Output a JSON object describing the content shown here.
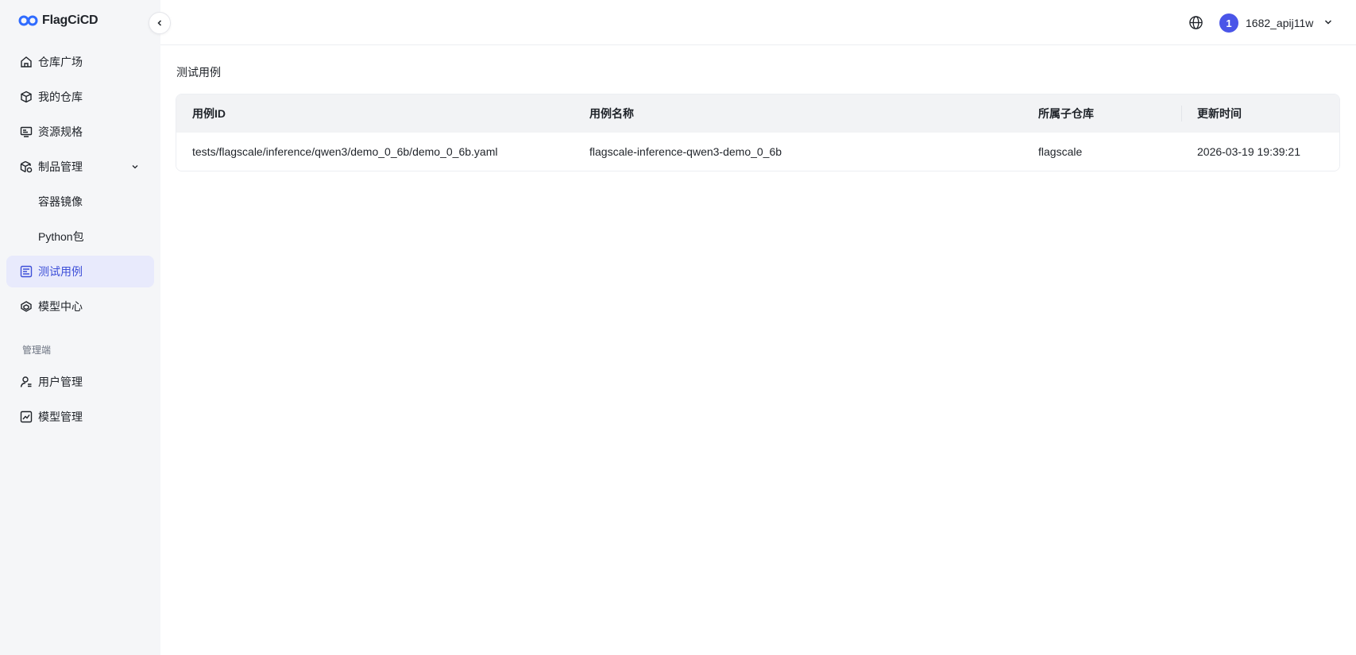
{
  "app": {
    "logo_text": "FlagCiCD"
  },
  "sidebar": {
    "items": [
      {
        "label": "仓库广场",
        "icon": "home-icon"
      },
      {
        "label": "我的仓库",
        "icon": "cube-icon"
      },
      {
        "label": "资源规格",
        "icon": "monitor-icon"
      },
      {
        "label": "制品管理",
        "icon": "package-icon",
        "expanded": true
      },
      {
        "label": "容器镜像"
      },
      {
        "label": "Python包"
      },
      {
        "label": "测试用例",
        "icon": "testcase-icon",
        "active": true
      },
      {
        "label": "模型中心",
        "icon": "model-icon"
      }
    ],
    "admin_section_label": "管理端",
    "admin_items": [
      {
        "label": "用户管理",
        "icon": "user-icon"
      },
      {
        "label": "模型管理",
        "icon": "chart-icon"
      }
    ]
  },
  "header": {
    "language_icon": "globe-icon",
    "avatar_text": "1",
    "username": "1682_apij11w"
  },
  "main": {
    "title": "测试用例",
    "table": {
      "columns": [
        "用例ID",
        "用例名称",
        "所属子仓库",
        "更新时间"
      ],
      "rows": [
        {
          "id": "tests/flagscale/inference/qwen3/demo_0_6b/demo_0_6b.yaml",
          "name": "flagscale-inference-qwen3-demo_0_6b",
          "repo": "flagscale",
          "updated": "2026-03-19 19:39:21"
        }
      ]
    }
  },
  "colors": {
    "accent": "#3d4fd8",
    "active_bg": "#e8eafc",
    "sidebar_bg": "#f5f6f8"
  }
}
